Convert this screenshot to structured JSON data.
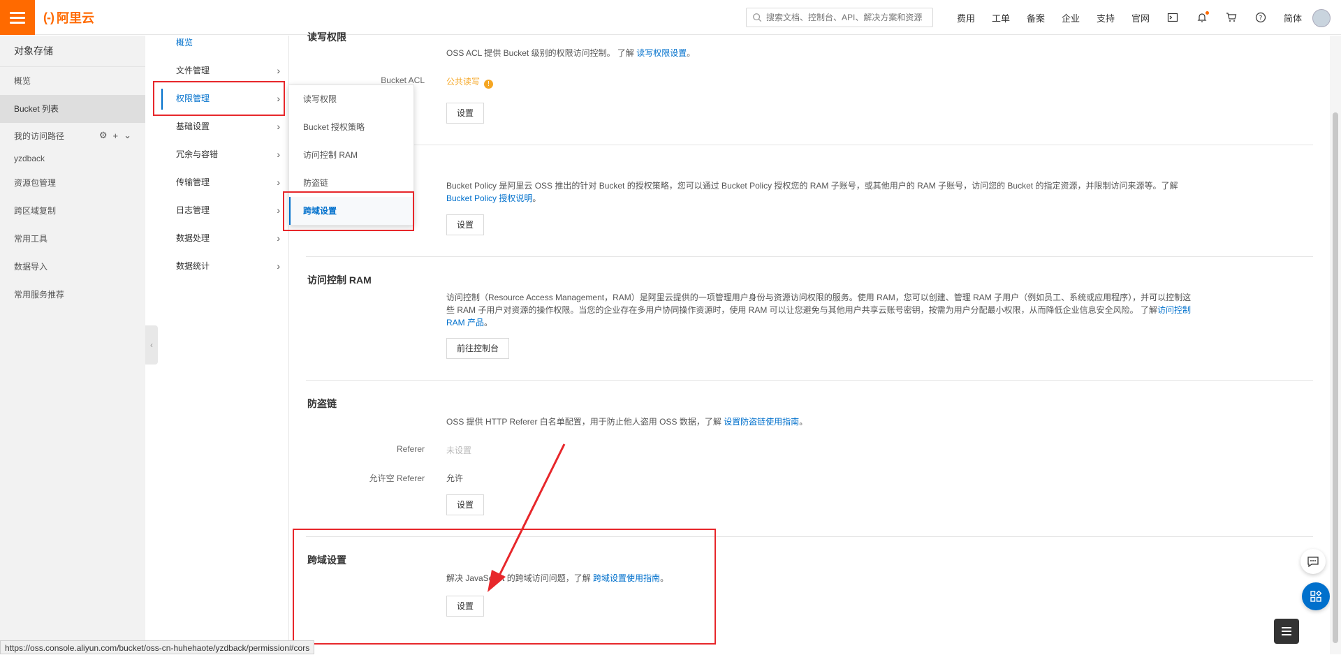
{
  "brand": {
    "logo_mark": "(-)",
    "logo_text": "阿里云",
    "accent": "#ff6a00"
  },
  "search": {
    "placeholder": "搜索文档、控制台、API、解决方案和资源"
  },
  "topnav": [
    "费用",
    "工单",
    "备案",
    "企业",
    "支持",
    "官网"
  ],
  "topnav_lang": "简体",
  "sidebar": {
    "title": "对象存储",
    "items": [
      "概览",
      "Bucket 列表"
    ],
    "paths_label": "我的访问路径",
    "bucket": "yzdback",
    "more": [
      "资源包管理",
      "跨区域复制",
      "常用工具",
      "数据导入",
      "常用服务推荐"
    ]
  },
  "subnav": {
    "overview": "概览",
    "items": [
      "文件管理",
      "权限管理",
      "基础设置",
      "冗余与容错",
      "传输管理",
      "日志管理",
      "数据处理",
      "数据统计"
    ]
  },
  "flyout": [
    "读写权限",
    "Bucket 授权策略",
    "访问控制 RAM",
    "防盗链",
    "跨域设置"
  ],
  "sections": {
    "acl": {
      "title": "读写权限",
      "desc_prefix": "OSS ACL 提供 Bucket 级别的权限访问控制。 了解",
      "desc_link": "读写权限设置",
      "label": "Bucket ACL",
      "value": "公共读写",
      "button": "设置"
    },
    "policy": {
      "desc_prefix": "Bucket Policy 是阿里云 OSS 推出的针对 Bucket 的授权策略，您可以通过 Bucket Policy 授权您的 RAM 子账号，或其他用户的 RAM 子账号，访问您的 Bucket 的指定资源，并限制访问来源等。了解",
      "desc_link": "Bucket Policy 授权说明",
      "button": "设置"
    },
    "ram": {
      "title": "访问控制 RAM",
      "desc_prefix": "访问控制（Resource Access Management，RAM）是阿里云提供的一项管理用户身份与资源访问权限的服务。使用 RAM，您可以创建、管理 RAM 子用户（例如员工、系统或应用程序），并可以控制这些 RAM 子用户对资源的操作权限。当您的企业存在多用户协同操作资源时，使用 RAM 可以让您避免与其他用户共享云账号密钥，按需为用户分配最小权限，从而降低企业信息安全风险。 了解",
      "desc_link": "访问控制 RAM 产品",
      "button": "前往控制台"
    },
    "referer": {
      "title": "防盗链",
      "desc_prefix": "OSS 提供 HTTP Referer 白名单配置，用于防止他人盗用 OSS 数据，了解",
      "desc_link": "设置防盗链使用指南",
      "label_referer": "Referer",
      "value_referer": "未设置",
      "label_empty": "允许空 Referer",
      "value_empty": "允许",
      "button": "设置"
    },
    "cors": {
      "title": "跨域设置",
      "desc_prefix": "解决 JavaScript 的跨域访问问题，了解",
      "desc_link": "跨域设置使用指南",
      "button": "设置"
    }
  },
  "status_url": "https://oss.console.aliyun.com/bucket/oss-cn-huhehaote/yzdback/permission#cors"
}
